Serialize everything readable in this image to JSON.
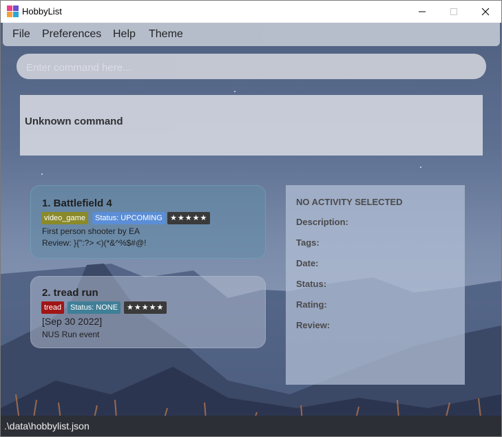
{
  "window": {
    "title": "HobbyList"
  },
  "menu": {
    "items": [
      "File",
      "Preferences",
      "Help",
      "Theme"
    ]
  },
  "command": {
    "placeholder": "Enter command here...",
    "value": ""
  },
  "result": {
    "text": "Unknown command"
  },
  "activities": [
    {
      "title": "1.  Battlefield 4",
      "tag": "video_game",
      "status": "Status: UPCOMING",
      "rating": "★★★★★",
      "date": "",
      "description": "First person shooter by EA",
      "review": "Review: }{\":?> <)(*&^%$#@!"
    },
    {
      "title": "2.  tread run",
      "tag": "tread",
      "status": "Status: NONE",
      "rating": "★★★★★",
      "date": "[Sep 30 2022]",
      "description": "NUS Run event",
      "review": ""
    }
  ],
  "detail": {
    "heading": "NO ACTIVITY SELECTED",
    "labels": [
      "Description:",
      "Tags:",
      "Date:",
      "Status:",
      "Rating:",
      "Review:"
    ]
  },
  "status_bar": {
    "path": ".\\data\\hobbylist.json"
  },
  "colors": {
    "tag_video_game": "#8a8a2a",
    "tag_tread": "#a01515",
    "status_upcoming": "#5b8ed6",
    "status_none": "#3f7f97",
    "rating_bg": "#3a3a3a"
  }
}
